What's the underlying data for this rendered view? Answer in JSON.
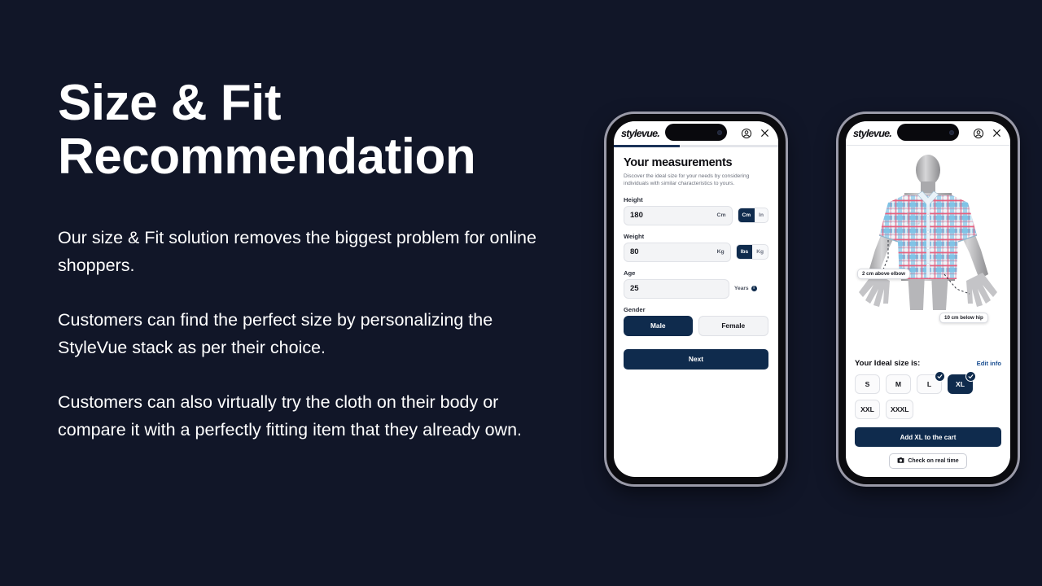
{
  "theme": {
    "background": "#111628",
    "navy": "#0f2b4d",
    "link_blue": "#1b4f91",
    "text_white": "#ffffff"
  },
  "left": {
    "headline": "Size & Fit\nRecommendation",
    "paragraphs": [
      "Our size & Fit solution removes the biggest problem for online shoppers.",
      "Customers can find the perfect size by personalizing the StyleVue stack as per their choice.",
      "Customers can also virtually try the cloth on their body or compare it with a perfectly fitting item that they already own."
    ]
  },
  "phone_measurements": {
    "appbar": {
      "logo": "stylevue.",
      "account_icon": "account-circle-icon",
      "close_icon": "close-icon"
    },
    "progress_percent": 40,
    "title": "Your measurements",
    "subtitle": "Discover the ideal size for your needs by considering individuals with similar characteristics to yours.",
    "fields": [
      {
        "label": "Height",
        "value": "180",
        "unit_suffix": "Cm",
        "toggle": [
          "Cm",
          "In"
        ],
        "toggle_active": "Cm"
      },
      {
        "label": "Weight",
        "value": "80",
        "unit_suffix": "Kg",
        "toggle": [
          "lbs",
          "Kg"
        ],
        "toggle_active": "lbs"
      }
    ],
    "age": {
      "label": "Age",
      "value": "25",
      "unit_label": "Years",
      "info_icon": "info-icon"
    },
    "gender": {
      "label": "Gender",
      "options": [
        "Male",
        "Female"
      ],
      "selected": "Male"
    },
    "next_label": "Next"
  },
  "phone_tryon": {
    "appbar": {
      "logo": "stylevue.",
      "account_icon": "account-circle-icon",
      "close_icon": "close-icon"
    },
    "annotations": [
      {
        "text": "2 cm above elbow"
      },
      {
        "text": "10 cm below hip"
      }
    ],
    "sizes_title": "Your Ideal size is:",
    "edit_link": "Edit info",
    "sizes": [
      {
        "label": "S",
        "selected": false,
        "checked": false
      },
      {
        "label": "M",
        "selected": false,
        "checked": false
      },
      {
        "label": "L",
        "selected": false,
        "checked": true
      },
      {
        "label": "XL",
        "selected": true,
        "checked": true
      },
      {
        "label": "XXL",
        "selected": false,
        "checked": false
      },
      {
        "label": "XXXL",
        "selected": false,
        "checked": false
      }
    ],
    "cart_label": "Add XL to the cart",
    "realtime_label": "Check on real time",
    "camera_icon": "camera-icon"
  }
}
